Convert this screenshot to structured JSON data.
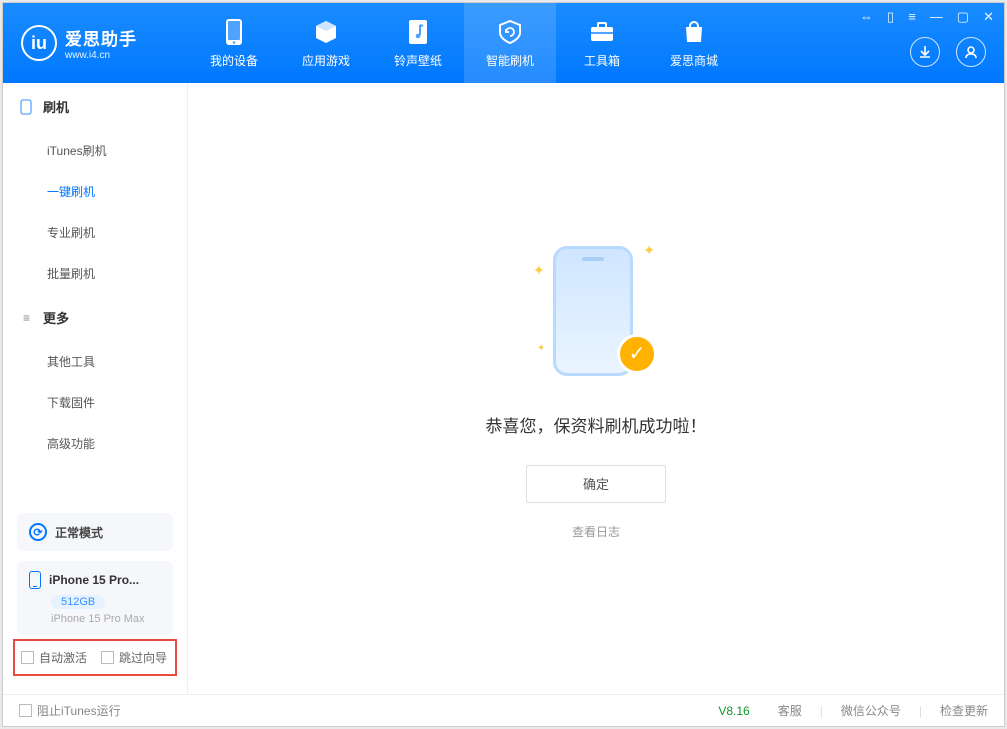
{
  "app": {
    "title": "爱思助手",
    "url": "www.i4.cn"
  },
  "nav": {
    "items": [
      {
        "label": "我的设备"
      },
      {
        "label": "应用游戏"
      },
      {
        "label": "铃声壁纸"
      },
      {
        "label": "智能刷机"
      },
      {
        "label": "工具箱"
      },
      {
        "label": "爱思商城"
      }
    ],
    "active_index": 3
  },
  "sidebar": {
    "groups": [
      {
        "header": "刷机",
        "items": [
          "iTunes刷机",
          "一键刷机",
          "专业刷机",
          "批量刷机"
        ],
        "active_index": 1
      },
      {
        "header": "更多",
        "items": [
          "其他工具",
          "下载固件",
          "高级功能"
        ],
        "active_index": -1
      }
    ],
    "status_label": "正常模式",
    "device": {
      "name": "iPhone 15 Pro...",
      "capacity": "512GB",
      "model": "iPhone 15 Pro Max"
    },
    "checks": {
      "auto_activate": "自动激活",
      "skip_guide": "跳过向导"
    }
  },
  "main": {
    "success_message": "恭喜您，保资料刷机成功啦！",
    "confirm_label": "确定",
    "view_log_label": "查看日志"
  },
  "footer": {
    "block_itunes": "阻止iTunes运行",
    "version": "V8.16",
    "links": [
      "客服",
      "微信公众号",
      "检查更新"
    ]
  }
}
